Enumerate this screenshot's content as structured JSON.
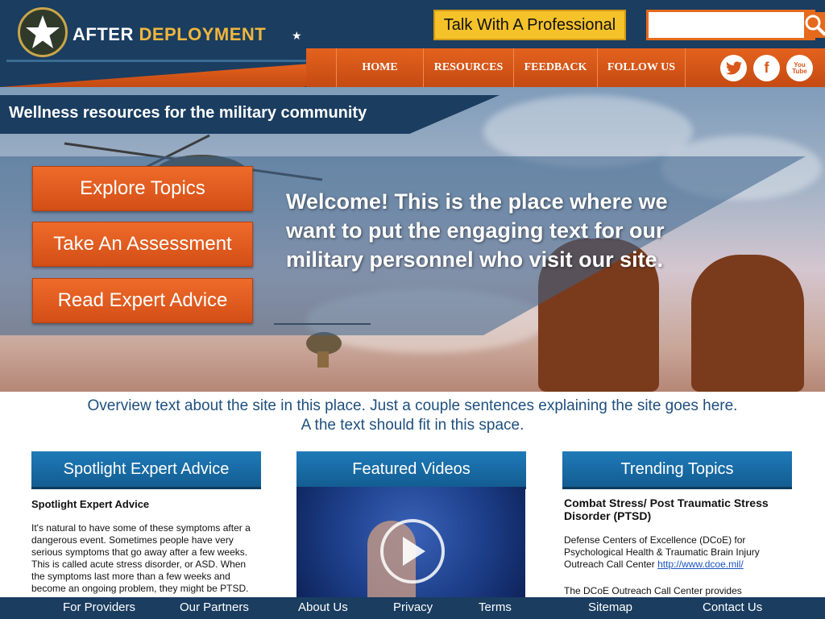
{
  "brand": {
    "after": "AFTER",
    "deployment": "DEPLOYMENT",
    "logo_icon": "star-badge",
    "colors": {
      "navy": "#1a3d60",
      "orange": "#e4621e",
      "gold": "#f0b63c",
      "yellow_btn": "#f5c22a"
    }
  },
  "header": {
    "talk_label": "Talk With A Professional",
    "search": {
      "placeholder": "",
      "value": "",
      "icon": "magnifier-icon"
    },
    "nav": [
      "HOME",
      "RESOURCES",
      "FEEDBACK",
      "FOLLOW US"
    ],
    "social": [
      {
        "name": "twitter",
        "glyph": "t"
      },
      {
        "name": "facebook",
        "glyph": "f"
      },
      {
        "name": "youtube",
        "glyph": "You Tube"
      }
    ]
  },
  "hero": {
    "tagline": "Wellness resources for the military community",
    "ctas": [
      "Explore Topics",
      "Take An Assessment",
      "Read Expert Advice"
    ],
    "welcome": "Welcome! This is the place where we want to put the engaging text for our military personnel who visit our site."
  },
  "overview": {
    "line1": "Overview text about the site in this place. Just a couple sentences explaining the site goes here.",
    "line2": "A the text should fit in this space."
  },
  "columns": {
    "spotlight": {
      "heading": "Spotlight Expert Advice",
      "title": "Spotlight Expert Advice",
      "body": "It's natural to have some of these symptoms after a dangerous event. Sometimes people have very serious symptoms that go away after a few weeks. This is called acute stress disorder, or ASD. When the symptoms last more than a few weeks and become an ongoing problem, they might be PTSD. Some people"
    },
    "videos": {
      "heading": "Featured Videos",
      "icon": "play-icon"
    },
    "trending": {
      "heading": "Trending Topics",
      "title": "Combat Stress/ Post Traumatic Stress Disorder (PTSD)",
      "body1": "Defense Centers of Excellence (DCoE) for Psychological Health & Traumatic Brain Injury Outreach Call Center",
      "link": "http://www.dcoe.mil/",
      "body2": "The DCoE Outreach Call Center provides"
    }
  },
  "footer": [
    "For Providers",
    "Our Partners",
    "About Us",
    "Privacy",
    "Terms",
    "Sitemap",
    "Contact Us"
  ]
}
